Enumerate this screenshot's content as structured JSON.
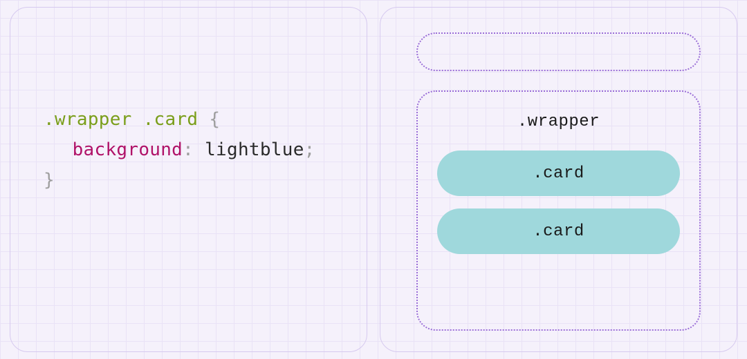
{
  "code": {
    "selector": ".wrapper .card",
    "open_brace": "{",
    "property": "background",
    "colon": ":",
    "value": "lightblue",
    "semicolon": ";",
    "close_brace": "}"
  },
  "diagram": {
    "wrapper_label": ".wrapper",
    "cards": [
      {
        "label": ".card"
      },
      {
        "label": ".card"
      }
    ]
  },
  "colors": {
    "card_bg": "#9fd8dc",
    "dotted_border": "#9a6dd7"
  }
}
